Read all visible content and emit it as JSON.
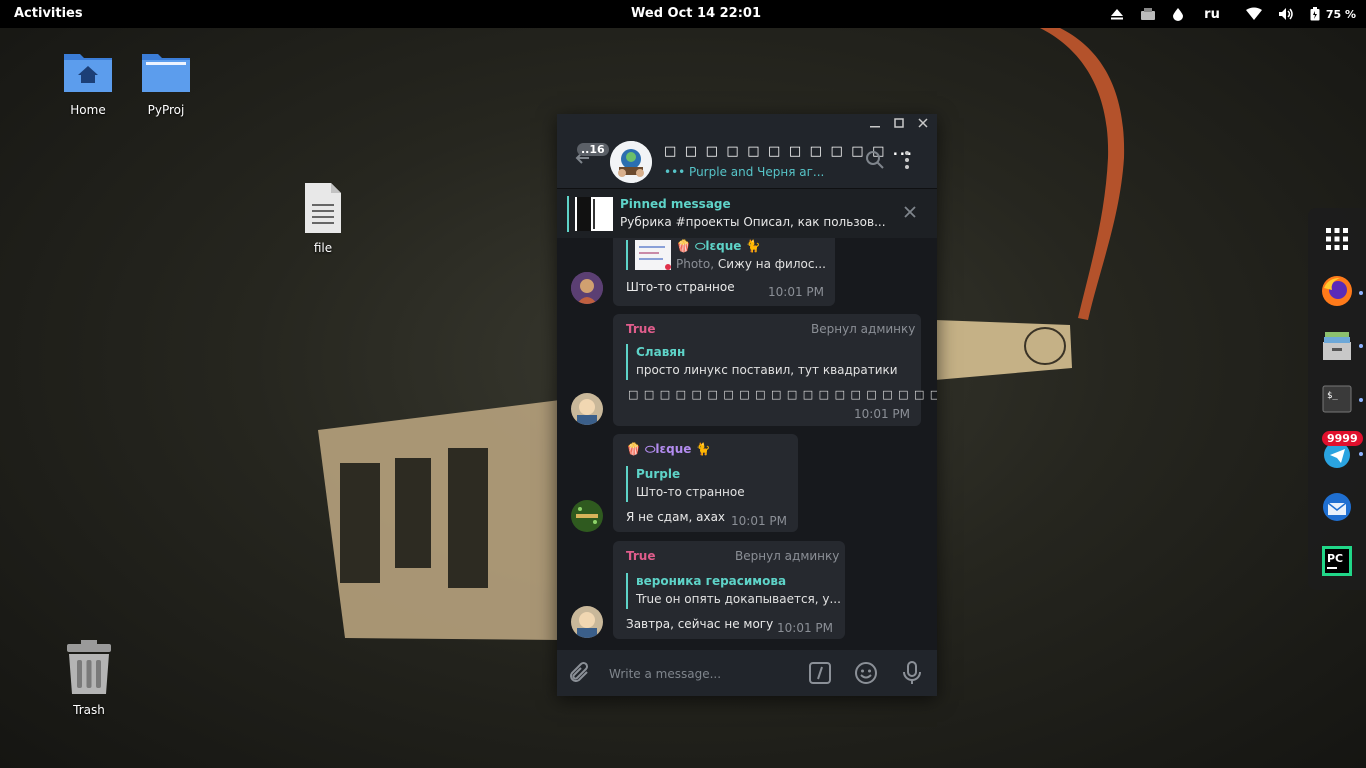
{
  "topbar": {
    "activities": "Activities",
    "clock": "Wed Oct 14  22:01",
    "keyboard_layout": "ru",
    "battery": "75 %"
  },
  "desktop": {
    "icons": [
      {
        "label": "Home"
      },
      {
        "label": "PyProj"
      },
      {
        "label": "file"
      },
      {
        "label": "Trash"
      }
    ]
  },
  "dock": {
    "items": [
      {
        "icon": "app-grid-icon"
      },
      {
        "icon": "firefox-icon"
      },
      {
        "icon": "archive-manager-icon"
      },
      {
        "icon": "terminal-icon"
      },
      {
        "icon": "telegram-icon"
      },
      {
        "icon": "thunderbird-icon"
      },
      {
        "icon": "pycharm-icon"
      }
    ],
    "telegram_badge": "9999"
  },
  "telegram": {
    "chat": {
      "unread_count": "..16",
      "title": "□ □ □ □ □ □ □ □ □ □ □ ...",
      "status": "••• Purple and Черня аг..."
    },
    "pinned": {
      "title": "Pinned message",
      "text": "Рубрика #проекты  Описал, как пользов..."
    },
    "messages": [
      {
        "reply_name": "🍿 ⬭lεque 🐈",
        "reply_prefix": "Photo,",
        "reply_text": "Сижу на филос...",
        "text": "Што-то странное",
        "time": "10:01 PM"
      },
      {
        "author": "True",
        "rank": "Вернул админку",
        "reply_name": "Славян",
        "reply_text": "просто линукс поставил, тут квадратики",
        "text": "□ □ □ □ □ □ □ □ □ □ □ □ □ □ □ □ □ □ □ □ □ □ □ □ □ □ □ □ □",
        "time": "10:01 PM"
      },
      {
        "author": "🍿 ⬭lεque 🐈",
        "reply_name": "Purple",
        "reply_text": "Што-то странное",
        "text": "Я не сдам, ахах",
        "time": "10:01 PM"
      },
      {
        "author": "True",
        "rank": "Вернул админку",
        "reply_name": "вероника герасимова",
        "reply_text": "True он опять докапывается, у...",
        "text": "Завтра, сейчас не могу",
        "time": "10:01 PM"
      }
    ],
    "composer": {
      "placeholder": "Write a message..."
    }
  },
  "colors": {
    "accent": "#5ed3c8",
    "author_true": "#e05d8c",
    "author_oleque": "#b38cf0",
    "bubble": "#26292f",
    "window_bg": "#17191d"
  }
}
